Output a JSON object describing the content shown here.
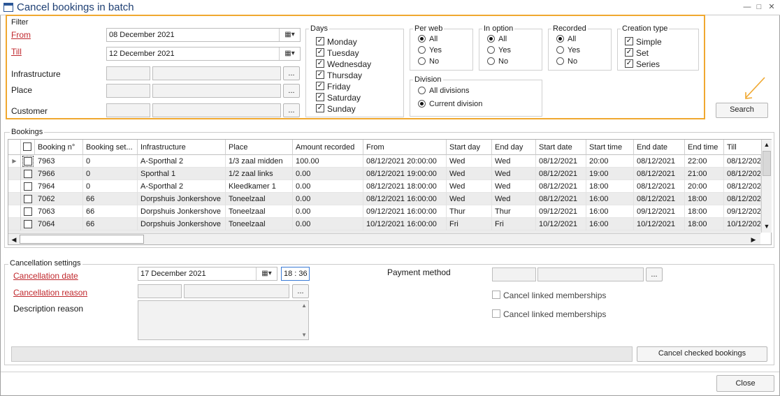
{
  "window": {
    "title": "Cancel bookings in batch"
  },
  "filter": {
    "label": "Filter",
    "from_label": "From",
    "from_value": "08 December 2021",
    "till_label": "Till",
    "till_value": "12 December 2021",
    "infrastructure_label": "Infrastructure",
    "place_label": "Place",
    "customer_label": "Customer",
    "browse": "...",
    "days": {
      "label": "Days",
      "items": [
        "Monday",
        "Tuesday",
        "Wednesday",
        "Thursday",
        "Friday",
        "Saturday",
        "Sunday"
      ]
    },
    "per_web": {
      "label": "Per web",
      "options": [
        "All",
        "Yes",
        "No"
      ],
      "selected": "All"
    },
    "in_option": {
      "label": "In option",
      "options": [
        "All",
        "Yes",
        "No"
      ],
      "selected": "All"
    },
    "recorded": {
      "label": "Recorded",
      "options": [
        "All",
        "Yes",
        "No"
      ],
      "selected": "All"
    },
    "creation_type": {
      "label": "Creation type",
      "items": [
        "Simple",
        "Set",
        "Series"
      ]
    },
    "division": {
      "label": "Division",
      "options": [
        "All divisions",
        "Current division"
      ],
      "selected": "Current division"
    },
    "search_label": "Search"
  },
  "bookings": {
    "label": "Bookings",
    "columns": [
      "Booking n°",
      "Booking set...",
      "Infrastructure",
      "Place",
      "Amount recorded",
      "From",
      "Start day",
      "End day",
      "Start date",
      "Start time",
      "End date",
      "End time",
      "Till"
    ],
    "rows": [
      [
        "7963",
        "0",
        "A-Sporthal 2",
        "1/3 zaal midden",
        "100.00",
        "08/12/2021 20:00:00",
        "Wed",
        "Wed",
        "08/12/2021",
        "20:00",
        "08/12/2021",
        "22:00",
        "08/12/202"
      ],
      [
        "7966",
        "0",
        "Sporthal 1",
        "1/2  zaal links",
        "0.00",
        "08/12/2021 19:00:00",
        "Wed",
        "Wed",
        "08/12/2021",
        "19:00",
        "08/12/2021",
        "21:00",
        "08/12/202"
      ],
      [
        "7964",
        "0",
        "A-Sporthal 2",
        "Kleedkamer 1",
        "0.00",
        "08/12/2021 18:00:00",
        "Wed",
        "Wed",
        "08/12/2021",
        "18:00",
        "08/12/2021",
        "20:00",
        "08/12/202"
      ],
      [
        "7062",
        "66",
        "Dorpshuis Jonkershove",
        "Toneelzaal",
        "0.00",
        "08/12/2021 16:00:00",
        "Wed",
        "Wed",
        "08/12/2021",
        "16:00",
        "08/12/2021",
        "18:00",
        "08/12/202"
      ],
      [
        "7063",
        "66",
        "Dorpshuis Jonkershove",
        "Toneelzaal",
        "0.00",
        "09/12/2021 16:00:00",
        "Thur",
        "Thur",
        "09/12/2021",
        "16:00",
        "09/12/2021",
        "18:00",
        "09/12/202"
      ],
      [
        "7064",
        "66",
        "Dorpshuis Jonkershove",
        "Toneelzaal",
        "0.00",
        "10/12/2021 16:00:00",
        "Fri",
        "Fri",
        "10/12/2021",
        "16:00",
        "10/12/2021",
        "18:00",
        "10/12/202"
      ]
    ]
  },
  "cancellation": {
    "label": "Cancellation settings",
    "date_label": "Cancellation date",
    "date_value": "17 December 2021",
    "time_value": "18 : 36",
    "reason_label": "Cancellation reason",
    "description_label": "Description reason",
    "payment_label": "Payment method",
    "linked_1": "Cancel linked memberships",
    "linked_2": "Cancel linked memberships",
    "cancel_checked_label": "Cancel checked bookings"
  },
  "footer": {
    "close_label": "Close"
  },
  "colors": {
    "accent": "#f0a830",
    "required": "#c0282d",
    "title": "#1e3f73"
  }
}
